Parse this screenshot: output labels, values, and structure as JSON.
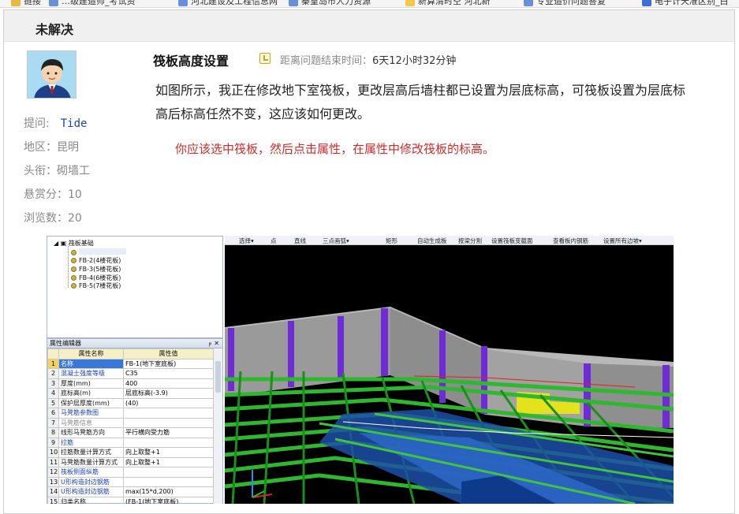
{
  "bookmarks": [
    {
      "label": "链接",
      "icon": "folder-icon",
      "kind": "folder"
    },
    {
      "label": "…级建造师_考试资",
      "icon": "page-icon",
      "kind": "page"
    },
    {
      "label": "河北建设及工程信息网",
      "icon": "page-icon",
      "kind": "page"
    },
    {
      "label": "秦皇岛市人力资源",
      "icon": "page-icon",
      "kind": "page"
    },
    {
      "label": "新算清时空 河北新",
      "icon": "page-icon",
      "kind": "yellow"
    },
    {
      "label": "专业造价问题答复",
      "icon": "page-icon",
      "kind": "page"
    },
    {
      "label": "电子计天准区别_白",
      "icon": "page-icon",
      "kind": "blue"
    }
  ],
  "section": {
    "title": "未解决"
  },
  "user": {
    "asker_label": "提问:",
    "asker_name": "Tide",
    "region": "地区：昆明",
    "rank": "头衔：砌墙工",
    "bounty": "悬赏分：10",
    "views": "浏览数：20"
  },
  "question": {
    "title": "筏板高度设置",
    "deadline_label": "距离问题结束时间：",
    "deadline_value": "6天12小时32分钟",
    "body": "如图所示，我正在修改地下室筏板，更改层高后墙柱都已设置为层底标高，可筏板设置为层底标高后标高任然不变，这应该如何更改。",
    "answer": "你应该选中筏板，然后点击属性，在属性中修改筏板的标高。"
  },
  "screenshot": {
    "tree": {
      "root": "筏板基础",
      "items": [
        "",
        "FB-2(4楼花板)",
        "FB-3(5楼花板)",
        "FB-4(6楼花板)",
        "FB-5(7楼花板)"
      ]
    },
    "props": {
      "title": "属性编辑器",
      "pin": "ⲣ",
      "close": "✕",
      "headers": [
        "",
        "属性名称",
        "属性值"
      ],
      "rows": [
        {
          "n": "1",
          "name": "名称",
          "value": "FB-1(地下室底板)",
          "style": "selected"
        },
        {
          "n": "2",
          "name": "混凝土强度等级",
          "value": "C35",
          "style": "blue"
        },
        {
          "n": "3",
          "name": "厚度(mm)",
          "value": "400",
          "style": "plain"
        },
        {
          "n": "4",
          "name": "底标高(m)",
          "value": "层底标高(-3.9)",
          "style": "plain"
        },
        {
          "n": "5",
          "name": "保护层厚度(mm)",
          "value": "(40)",
          "style": "plain"
        },
        {
          "n": "6",
          "name": "马凳筋参数图",
          "value": "",
          "style": "blue"
        },
        {
          "n": "7",
          "name": "马凳筋信息",
          "value": "",
          "style": "gray"
        },
        {
          "n": "8",
          "name": "线形马凳筋方向",
          "value": "平行横向受力筋",
          "style": "plain"
        },
        {
          "n": "9",
          "name": "拉筋",
          "value": "",
          "style": "blue"
        },
        {
          "n": "10",
          "name": "拉筋数量计算方式",
          "value": "向上取整+1",
          "style": "plain"
        },
        {
          "n": "11",
          "name": "马凳筋数量计算方式",
          "value": "向上取整+1",
          "style": "plain"
        },
        {
          "n": "12",
          "name": "筏板侧面纵筋",
          "value": "",
          "style": "blue"
        },
        {
          "n": "13",
          "name": "U形构造封边钢筋",
          "value": "",
          "style": "blue"
        },
        {
          "n": "14",
          "name": "U形构造封边钢筋",
          "value": "max(15*d,200)",
          "style": "blue"
        },
        {
          "n": "15",
          "name": "归类名称",
          "value": "(FB-1(地下室底板)",
          "style": "plain"
        }
      ]
    },
    "toolbar": [
      "选择▾",
      "点",
      "直线",
      "三点画弧▾",
      "矩形",
      "自动生成板",
      "按梁分割",
      "设置筏板变截面",
      "查看板内钢筋",
      "设置所有边坡▾"
    ]
  },
  "colors": {
    "answer": "#d02a2a",
    "link": "#1a3fb7",
    "label": "#888888"
  }
}
